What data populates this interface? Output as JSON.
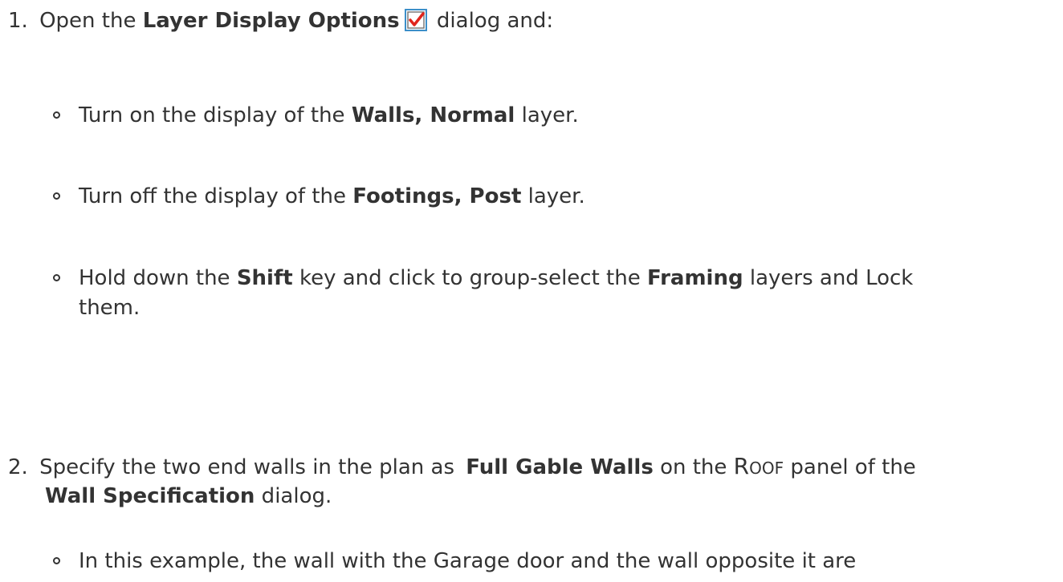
{
  "steps": [
    {
      "number": "1.",
      "text_before": "Open the ",
      "bold": "Layer Display Options",
      "icon": "layer-display-options-icon",
      "text_after": " dialog and:",
      "sub_items": [
        {
          "pre": "Turn on the display of the ",
          "bold": "Walls, Normal",
          "post": " layer."
        },
        {
          "pre": "Turn off the display of the ",
          "bold": "Footings, Post",
          "post": " layer."
        },
        {
          "pre": "Hold down the ",
          "bold1": "Shift",
          "mid": " key and click to group-select the ",
          "bold2": "Framing",
          "post_line1": " layers and Lock",
          "post_line2": "them."
        }
      ]
    },
    {
      "number": "2.",
      "line1_pre": "Specify the two end walls in the plan as ",
      "line1_bold": "Full Gable Walls",
      "line1_mid": " on the ",
      "smallcaps_R": "R",
      "smallcaps_rest": "OOF",
      "line1_post": " panel of the",
      "line2_bold": "Wall Specification",
      "line2_post": " dialog.",
      "sub_items": [
        {
          "text": "In this example, the wall with the Garage door and the wall opposite it are"
        }
      ]
    }
  ],
  "colors": {
    "text": "#333333",
    "icon_border": "#3c8fc9",
    "icon_check": "#e0241c"
  }
}
